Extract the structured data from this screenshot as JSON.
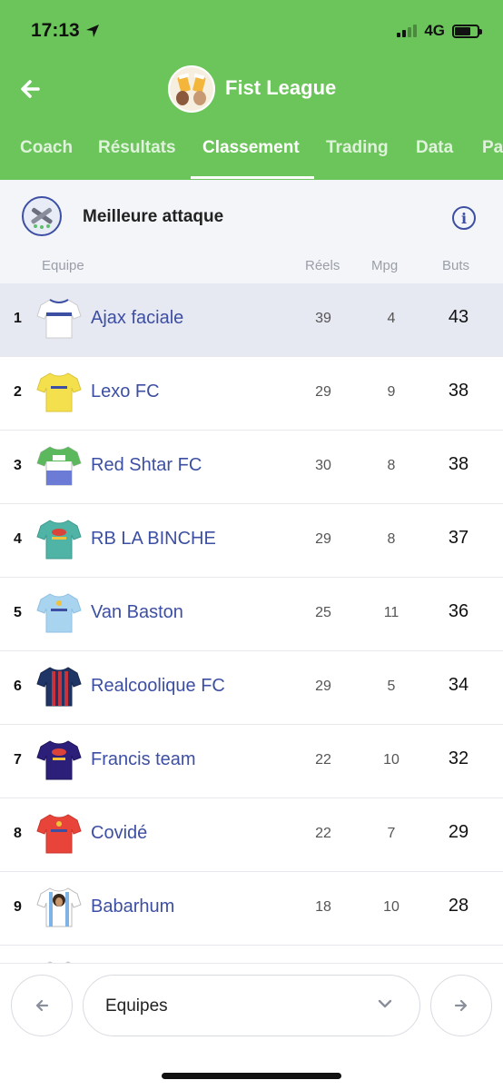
{
  "status_bar": {
    "time": "17:13",
    "network": "4G"
  },
  "header": {
    "league_name": "Fist League"
  },
  "tabs": [
    {
      "label": "Coach",
      "active": false
    },
    {
      "label": "Résultats",
      "active": false
    },
    {
      "label": "Classement",
      "active": true
    },
    {
      "label": "Trading",
      "active": false
    },
    {
      "label": "Data",
      "active": false
    },
    {
      "label": "Pa",
      "active": false
    }
  ],
  "section": {
    "title": "Meilleure attaque",
    "columns": {
      "team": "Equipe",
      "reels": "Réels",
      "mpg": "Mpg",
      "buts": "Buts"
    }
  },
  "rows": [
    {
      "rank": "1",
      "team": "Ajax faciale",
      "reels": "39",
      "mpg": "4",
      "buts": "43",
      "jersey": "white-blue-stripe"
    },
    {
      "rank": "2",
      "team": "Lexo FC",
      "reels": "29",
      "mpg": "9",
      "buts": "38",
      "jersey": "yellow"
    },
    {
      "rank": "3",
      "team": "Red Shtar FC",
      "reels": "30",
      "mpg": "8",
      "buts": "38",
      "jersey": "green-blue"
    },
    {
      "rank": "4",
      "team": "RB LA BINCHE",
      "reels": "29",
      "mpg": "8",
      "buts": "37",
      "jersey": "teal"
    },
    {
      "rank": "5",
      "team": "Van Baston",
      "reels": "25",
      "mpg": "11",
      "buts": "36",
      "jersey": "light-blue"
    },
    {
      "rank": "6",
      "team": "Realcoolique FC",
      "reels": "29",
      "mpg": "5",
      "buts": "34",
      "jersey": "navy-red-stripes"
    },
    {
      "rank": "7",
      "team": "Francis team",
      "reels": "22",
      "mpg": "10",
      "buts": "32",
      "jersey": "purple"
    },
    {
      "rank": "8",
      "team": "Covidé",
      "reels": "22",
      "mpg": "7",
      "buts": "29",
      "jersey": "red"
    },
    {
      "rank": "9",
      "team": "Babarhum",
      "reels": "18",
      "mpg": "10",
      "buts": "28",
      "jersey": "white-blue-stripes"
    }
  ],
  "bottom_bar": {
    "select_label": "Equipes"
  },
  "colors": {
    "header_green": "#6cc55a",
    "link_blue": "#3d4fa3",
    "highlight_row": "#e6e8f2"
  }
}
